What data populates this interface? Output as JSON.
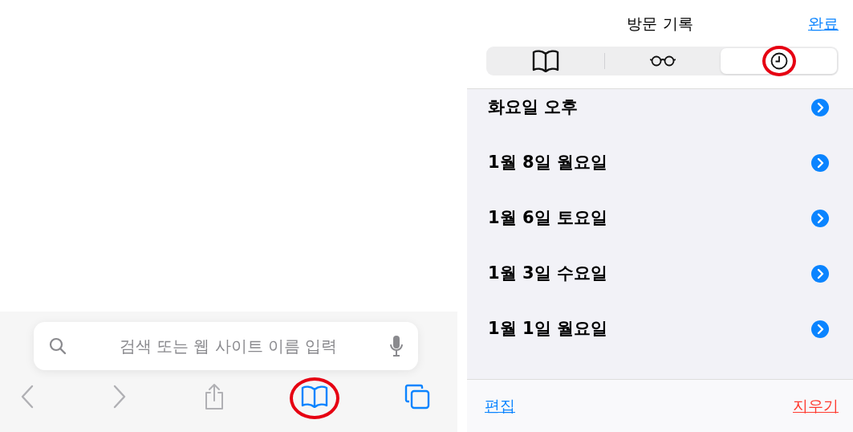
{
  "browser": {
    "search": {
      "placeholder": "검색 또는 웹 사이트 이름 입력"
    },
    "toolbar": [
      {
        "kind": "back",
        "disabled": true,
        "highlighted": false
      },
      {
        "kind": "forward",
        "disabled": true,
        "highlighted": false
      },
      {
        "kind": "share",
        "disabled": true,
        "highlighted": false
      },
      {
        "kind": "bookmarks",
        "disabled": false,
        "highlighted": true
      },
      {
        "kind": "tabs",
        "disabled": false,
        "highlighted": false
      }
    ]
  },
  "history": {
    "title": "방문 기록",
    "done": "완료",
    "tabs": [
      {
        "kind": "bookmarks",
        "selected": false,
        "highlighted": false
      },
      {
        "kind": "reading",
        "selected": false,
        "highlighted": false
      },
      {
        "kind": "history",
        "selected": true,
        "highlighted": true
      }
    ],
    "rows": [
      {
        "label": "화요일 오후"
      },
      {
        "label": "1월 8일 월요일"
      },
      {
        "label": "1월 6일 토요일"
      },
      {
        "label": "1월 3일 수요일"
      },
      {
        "label": "1월 1일 월요일"
      }
    ],
    "edit": "편집",
    "clear": "지우기"
  }
}
